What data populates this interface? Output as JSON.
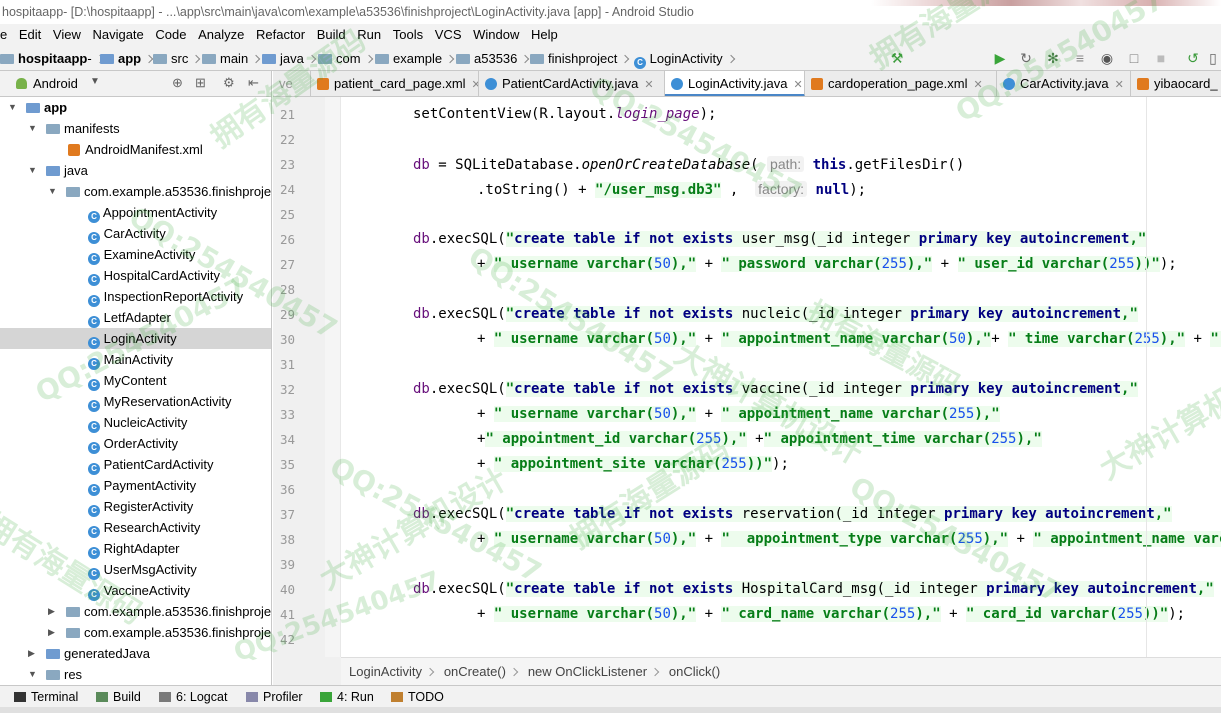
{
  "window": {
    "title": "hospitaapp- [D:\\hospitaapp] - ...\\app\\src\\main\\java\\com\\example\\a53536\\finishproject\\LoginActivity.java [app] - Android Studio"
  },
  "menu": [
    "e",
    "Edit",
    "View",
    "Navigate",
    "Code",
    "Analyze",
    "Refactor",
    "Build",
    "Run",
    "Tools",
    "VCS",
    "Window",
    "Help"
  ],
  "navbar": {
    "crumbs": [
      "hospitaapp",
      "app",
      "src",
      "main",
      "java",
      "com",
      "example",
      "a53536",
      "finishproject",
      "LoginActivity"
    ],
    "run_config": "app"
  },
  "project_panel": {
    "view_label": "Android",
    "tree": [
      {
        "label": "app",
        "bold": true
      },
      {
        "label": "manifests"
      },
      {
        "label": "AndroidManifest.xml"
      },
      {
        "label": "java"
      },
      {
        "label": "com.example.a53536.finishproje"
      },
      {
        "label": "AppointmentActivity"
      },
      {
        "label": "CarActivity"
      },
      {
        "label": "ExamineActivity"
      },
      {
        "label": "HospitalCardActivity"
      },
      {
        "label": "InspectionReportActivity"
      },
      {
        "label": "LetfAdapter"
      },
      {
        "label": "LoginActivity",
        "selected": true
      },
      {
        "label": "MainActivity"
      },
      {
        "label": "MyContent"
      },
      {
        "label": "MyReservationActivity"
      },
      {
        "label": "NucleicActivity"
      },
      {
        "label": "OrderActivity"
      },
      {
        "label": "PatientCardActivity"
      },
      {
        "label": "PaymentActivity"
      },
      {
        "label": "RegisterActivity"
      },
      {
        "label": "ResearchActivity"
      },
      {
        "label": "RightAdapter"
      },
      {
        "label": "UserMsgActivity"
      },
      {
        "label": "VaccineActivity"
      },
      {
        "label": "com.example.a53536.finishproje"
      },
      {
        "label": "com.example.a53536.finishproje"
      },
      {
        "label": "generatedJava"
      },
      {
        "label": "res"
      }
    ]
  },
  "editor_tabs": [
    {
      "label": "ve"
    },
    {
      "label": "patient_card_page.xml",
      "type": "xml"
    },
    {
      "label": "PatientCardActivity.java",
      "type": "java"
    },
    {
      "label": "LoginActivity.java",
      "type": "java",
      "active": true
    },
    {
      "label": "cardoperation_page.xml",
      "type": "xml"
    },
    {
      "label": "CarActivity.java",
      "type": "java"
    },
    {
      "label": "yibaocard_",
      "type": "xml"
    }
  ],
  "line_numbers": [
    "21",
    "22",
    "23",
    "24",
    "25",
    "26",
    "27",
    "28",
    "29",
    "30",
    "31",
    "32",
    "33",
    "34",
    "35",
    "36",
    "37",
    "38",
    "39",
    "40",
    "41",
    "42"
  ],
  "code": {
    "l21": {
      "a": "setContentView(R.layout.",
      "b": "login_page",
      "c": ");"
    },
    "l23": {
      "a": "db",
      "b": " = SQLiteDatabase.",
      "c": "openOrCreateDatabase",
      "d": "(",
      "hint": "path:",
      "e": "this",
      "f": ".getFilesDir()"
    },
    "l24": {
      "a": ".toString() + ",
      "s": "\"/user_msg.db3\"",
      "b": " ,  ",
      "hint": "factory:",
      "c": "null",
      "d": ");"
    },
    "l26": {
      "db": "db",
      "a": ".execSQL(",
      "q": "\"",
      "s1": "create table if not exists ",
      "t": "user_msg(_id integer ",
      "s2": "primary key autoincrement",
      "e": ",\""
    },
    "l27": {
      "a": "+ ",
      "s1": "\" username varchar(",
      "n1": "50",
      "s2": "),\"",
      "b": " + ",
      "s3": "\" password varchar(",
      "n2": "255",
      "s4": "),\"",
      "c": " + ",
      "s5": "\" user_id varchar(",
      "n3": "255",
      "s6": "))\"",
      "d": ");"
    },
    "l29": {
      "db": "db",
      "a": ".execSQL(",
      "q": "\"",
      "s1": "create table if not exists ",
      "t": "nucleic(_id integer ",
      "s2": "primary key autoincrement",
      "e": ",\""
    },
    "l30": {
      "a": "+ ",
      "s1": "\" username varchar(",
      "n1": "50",
      "s2": "),\"",
      "b": " + ",
      "s3": "\" appointment_name varchar(",
      "n2": "50",
      "s4": "),\"",
      "c": "+ ",
      "s5": "\" time varchar(",
      "n3": "255",
      "s6": "),\"",
      "d": " + ",
      "s7": "\" pla"
    },
    "l32": {
      "db": "db",
      "a": ".execSQL(",
      "q": "\"",
      "s1": "create table if not exists ",
      "t": "vaccine(_id integer ",
      "s2": "primary key autoincrement",
      "e": ",\""
    },
    "l33": {
      "a": "+ ",
      "s1": "\" username varchar(",
      "n1": "50",
      "s2": "),\"",
      "b": " + ",
      "s3": "\" appointment_name varchar(",
      "n2": "255",
      "s4": "),\""
    },
    "l34": {
      "a": "+",
      "s1": "\" appointment_id varchar(",
      "n1": "255",
      "s2": "),\"",
      "b": " +",
      "s3": "\" appointment_time varchar(",
      "n2": "255",
      "s4": "),\""
    },
    "l35": {
      "a": "+ ",
      "s1": "\" appointment_site varchar(",
      "n1": "255",
      "s2": "))\"",
      "b": ");"
    },
    "l37": {
      "db": "db",
      "a": ".execSQL(",
      "q": "\"",
      "s1": "create table if not exists ",
      "t": "reservation(_id integer ",
      "s2": "primary key autoincrement",
      "e": ",\""
    },
    "l38": {
      "a": "+ ",
      "s1": "\" username varchar(",
      "n1": "50",
      "s2": "),\"",
      "b": " + ",
      "s3": "\"  appointment_type varchar(",
      "n2": "255",
      "s4": "),\"",
      "c": " + ",
      "s5": "\" appointment_name varchar"
    },
    "l40": {
      "db": "db",
      "a": ".execSQL(",
      "q": "\"",
      "s1": "create table if not exists ",
      "t": "HospitalCard_msg(_id integer ",
      "s2": "primary key autoincrement",
      "e": ",\""
    },
    "l41": {
      "a": "+ ",
      "s1": "\" username varchar(",
      "n1": "50",
      "s2": "),\"",
      "b": " + ",
      "s3": "\" card_name varchar(",
      "n2": "255",
      "s4": "),\"",
      "c": " + ",
      "s5": "\" card_id varchar(",
      "n3": "255",
      "s6": "))\"",
      "d": ");"
    }
  },
  "editor_breadcrumb": [
    "LoginActivity",
    "onCreate()",
    "new OnClickListener",
    "onClick()"
  ],
  "tool_windows": [
    "Terminal",
    "Build",
    "6: Logcat",
    "Profiler",
    "4: Run",
    "TODO"
  ],
  "watermarks": [
    "QQ:254540457",
    "大神计算机设计",
    "拥有海量源码"
  ],
  "colors": {
    "string": "#067d17",
    "keyword": "#000080",
    "field": "#660e7a",
    "number": "#1750eb",
    "watermark": "#3caa3c",
    "selection": "#d5d5d5"
  }
}
